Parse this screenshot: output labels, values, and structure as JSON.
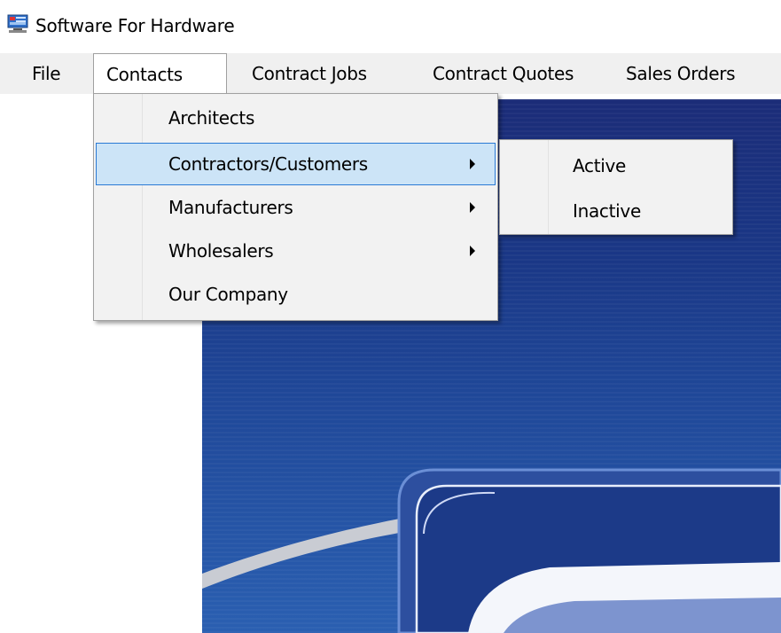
{
  "window": {
    "title": "Software For Hardware",
    "icon": "computer-app-icon"
  },
  "menubar": {
    "items": [
      {
        "label": "File"
      },
      {
        "label": "Contacts",
        "open": true
      },
      {
        "label": "Contract Jobs"
      },
      {
        "label": "Contract Quotes"
      },
      {
        "label": "Sales Orders"
      }
    ]
  },
  "contacts_menu": {
    "items": [
      {
        "label": "Architects",
        "submenu": false
      },
      {
        "label": "Contractors/Customers",
        "submenu": true,
        "highlighted": true
      },
      {
        "label": "Manufacturers",
        "submenu": true
      },
      {
        "label": "Wholesalers",
        "submenu": true
      },
      {
        "label": "Our Company",
        "submenu": false
      }
    ]
  },
  "contractors_submenu": {
    "items": [
      {
        "label": "Active"
      },
      {
        "label": "Inactive"
      }
    ]
  },
  "colors": {
    "menubar_bg": "#f0f0f0",
    "highlight_bg": "#cce4f7",
    "highlight_border": "#2a7ad5",
    "banner_dark": "#1b2c78",
    "banner_light": "#2a5fb1"
  }
}
